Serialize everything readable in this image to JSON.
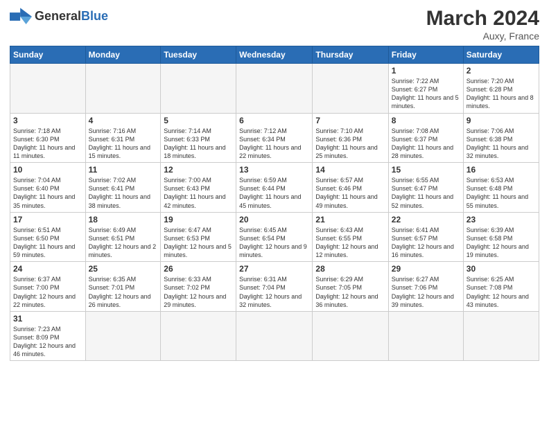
{
  "header": {
    "logo_general": "General",
    "logo_blue": "Blue",
    "month_year": "March 2024",
    "location": "Auxy, France"
  },
  "weekdays": [
    "Sunday",
    "Monday",
    "Tuesday",
    "Wednesday",
    "Thursday",
    "Friday",
    "Saturday"
  ],
  "weeks": [
    [
      {
        "day": "",
        "info": "",
        "empty": true
      },
      {
        "day": "",
        "info": "",
        "empty": true
      },
      {
        "day": "",
        "info": "",
        "empty": true
      },
      {
        "day": "",
        "info": "",
        "empty": true
      },
      {
        "day": "",
        "info": "",
        "empty": true
      },
      {
        "day": "1",
        "info": "Sunrise: 7:22 AM\nSunset: 6:27 PM\nDaylight: 11 hours\nand 5 minutes.",
        "empty": false
      },
      {
        "day": "2",
        "info": "Sunrise: 7:20 AM\nSunset: 6:28 PM\nDaylight: 11 hours\nand 8 minutes.",
        "empty": false
      }
    ],
    [
      {
        "day": "3",
        "info": "Sunrise: 7:18 AM\nSunset: 6:30 PM\nDaylight: 11 hours\nand 11 minutes.",
        "empty": false
      },
      {
        "day": "4",
        "info": "Sunrise: 7:16 AM\nSunset: 6:31 PM\nDaylight: 11 hours\nand 15 minutes.",
        "empty": false
      },
      {
        "day": "5",
        "info": "Sunrise: 7:14 AM\nSunset: 6:33 PM\nDaylight: 11 hours\nand 18 minutes.",
        "empty": false
      },
      {
        "day": "6",
        "info": "Sunrise: 7:12 AM\nSunset: 6:34 PM\nDaylight: 11 hours\nand 22 minutes.",
        "empty": false
      },
      {
        "day": "7",
        "info": "Sunrise: 7:10 AM\nSunset: 6:36 PM\nDaylight: 11 hours\nand 25 minutes.",
        "empty": false
      },
      {
        "day": "8",
        "info": "Sunrise: 7:08 AM\nSunset: 6:37 PM\nDaylight: 11 hours\nand 28 minutes.",
        "empty": false
      },
      {
        "day": "9",
        "info": "Sunrise: 7:06 AM\nSunset: 6:38 PM\nDaylight: 11 hours\nand 32 minutes.",
        "empty": false
      }
    ],
    [
      {
        "day": "10",
        "info": "Sunrise: 7:04 AM\nSunset: 6:40 PM\nDaylight: 11 hours\nand 35 minutes.",
        "empty": false
      },
      {
        "day": "11",
        "info": "Sunrise: 7:02 AM\nSunset: 6:41 PM\nDaylight: 11 hours\nand 38 minutes.",
        "empty": false
      },
      {
        "day": "12",
        "info": "Sunrise: 7:00 AM\nSunset: 6:43 PM\nDaylight: 11 hours\nand 42 minutes.",
        "empty": false
      },
      {
        "day": "13",
        "info": "Sunrise: 6:59 AM\nSunset: 6:44 PM\nDaylight: 11 hours\nand 45 minutes.",
        "empty": false
      },
      {
        "day": "14",
        "info": "Sunrise: 6:57 AM\nSunset: 6:46 PM\nDaylight: 11 hours\nand 49 minutes.",
        "empty": false
      },
      {
        "day": "15",
        "info": "Sunrise: 6:55 AM\nSunset: 6:47 PM\nDaylight: 11 hours\nand 52 minutes.",
        "empty": false
      },
      {
        "day": "16",
        "info": "Sunrise: 6:53 AM\nSunset: 6:48 PM\nDaylight: 11 hours\nand 55 minutes.",
        "empty": false
      }
    ],
    [
      {
        "day": "17",
        "info": "Sunrise: 6:51 AM\nSunset: 6:50 PM\nDaylight: 11 hours\nand 59 minutes.",
        "empty": false
      },
      {
        "day": "18",
        "info": "Sunrise: 6:49 AM\nSunset: 6:51 PM\nDaylight: 12 hours\nand 2 minutes.",
        "empty": false
      },
      {
        "day": "19",
        "info": "Sunrise: 6:47 AM\nSunset: 6:53 PM\nDaylight: 12 hours\nand 5 minutes.",
        "empty": false
      },
      {
        "day": "20",
        "info": "Sunrise: 6:45 AM\nSunset: 6:54 PM\nDaylight: 12 hours\nand 9 minutes.",
        "empty": false
      },
      {
        "day": "21",
        "info": "Sunrise: 6:43 AM\nSunset: 6:55 PM\nDaylight: 12 hours\nand 12 minutes.",
        "empty": false
      },
      {
        "day": "22",
        "info": "Sunrise: 6:41 AM\nSunset: 6:57 PM\nDaylight: 12 hours\nand 16 minutes.",
        "empty": false
      },
      {
        "day": "23",
        "info": "Sunrise: 6:39 AM\nSunset: 6:58 PM\nDaylight: 12 hours\nand 19 minutes.",
        "empty": false
      }
    ],
    [
      {
        "day": "24",
        "info": "Sunrise: 6:37 AM\nSunset: 7:00 PM\nDaylight: 12 hours\nand 22 minutes.",
        "empty": false
      },
      {
        "day": "25",
        "info": "Sunrise: 6:35 AM\nSunset: 7:01 PM\nDaylight: 12 hours\nand 26 minutes.",
        "empty": false
      },
      {
        "day": "26",
        "info": "Sunrise: 6:33 AM\nSunset: 7:02 PM\nDaylight: 12 hours\nand 29 minutes.",
        "empty": false
      },
      {
        "day": "27",
        "info": "Sunrise: 6:31 AM\nSunset: 7:04 PM\nDaylight: 12 hours\nand 32 minutes.",
        "empty": false
      },
      {
        "day": "28",
        "info": "Sunrise: 6:29 AM\nSunset: 7:05 PM\nDaylight: 12 hours\nand 36 minutes.",
        "empty": false
      },
      {
        "day": "29",
        "info": "Sunrise: 6:27 AM\nSunset: 7:06 PM\nDaylight: 12 hours\nand 39 minutes.",
        "empty": false
      },
      {
        "day": "30",
        "info": "Sunrise: 6:25 AM\nSunset: 7:08 PM\nDaylight: 12 hours\nand 43 minutes.",
        "empty": false
      }
    ],
    [
      {
        "day": "31",
        "info": "Sunrise: 7:23 AM\nSunset: 8:09 PM\nDaylight: 12 hours\nand 46 minutes.",
        "empty": false
      },
      {
        "day": "",
        "info": "",
        "empty": true
      },
      {
        "day": "",
        "info": "",
        "empty": true
      },
      {
        "day": "",
        "info": "",
        "empty": true
      },
      {
        "day": "",
        "info": "",
        "empty": true
      },
      {
        "day": "",
        "info": "",
        "empty": true
      },
      {
        "day": "",
        "info": "",
        "empty": true
      }
    ]
  ]
}
